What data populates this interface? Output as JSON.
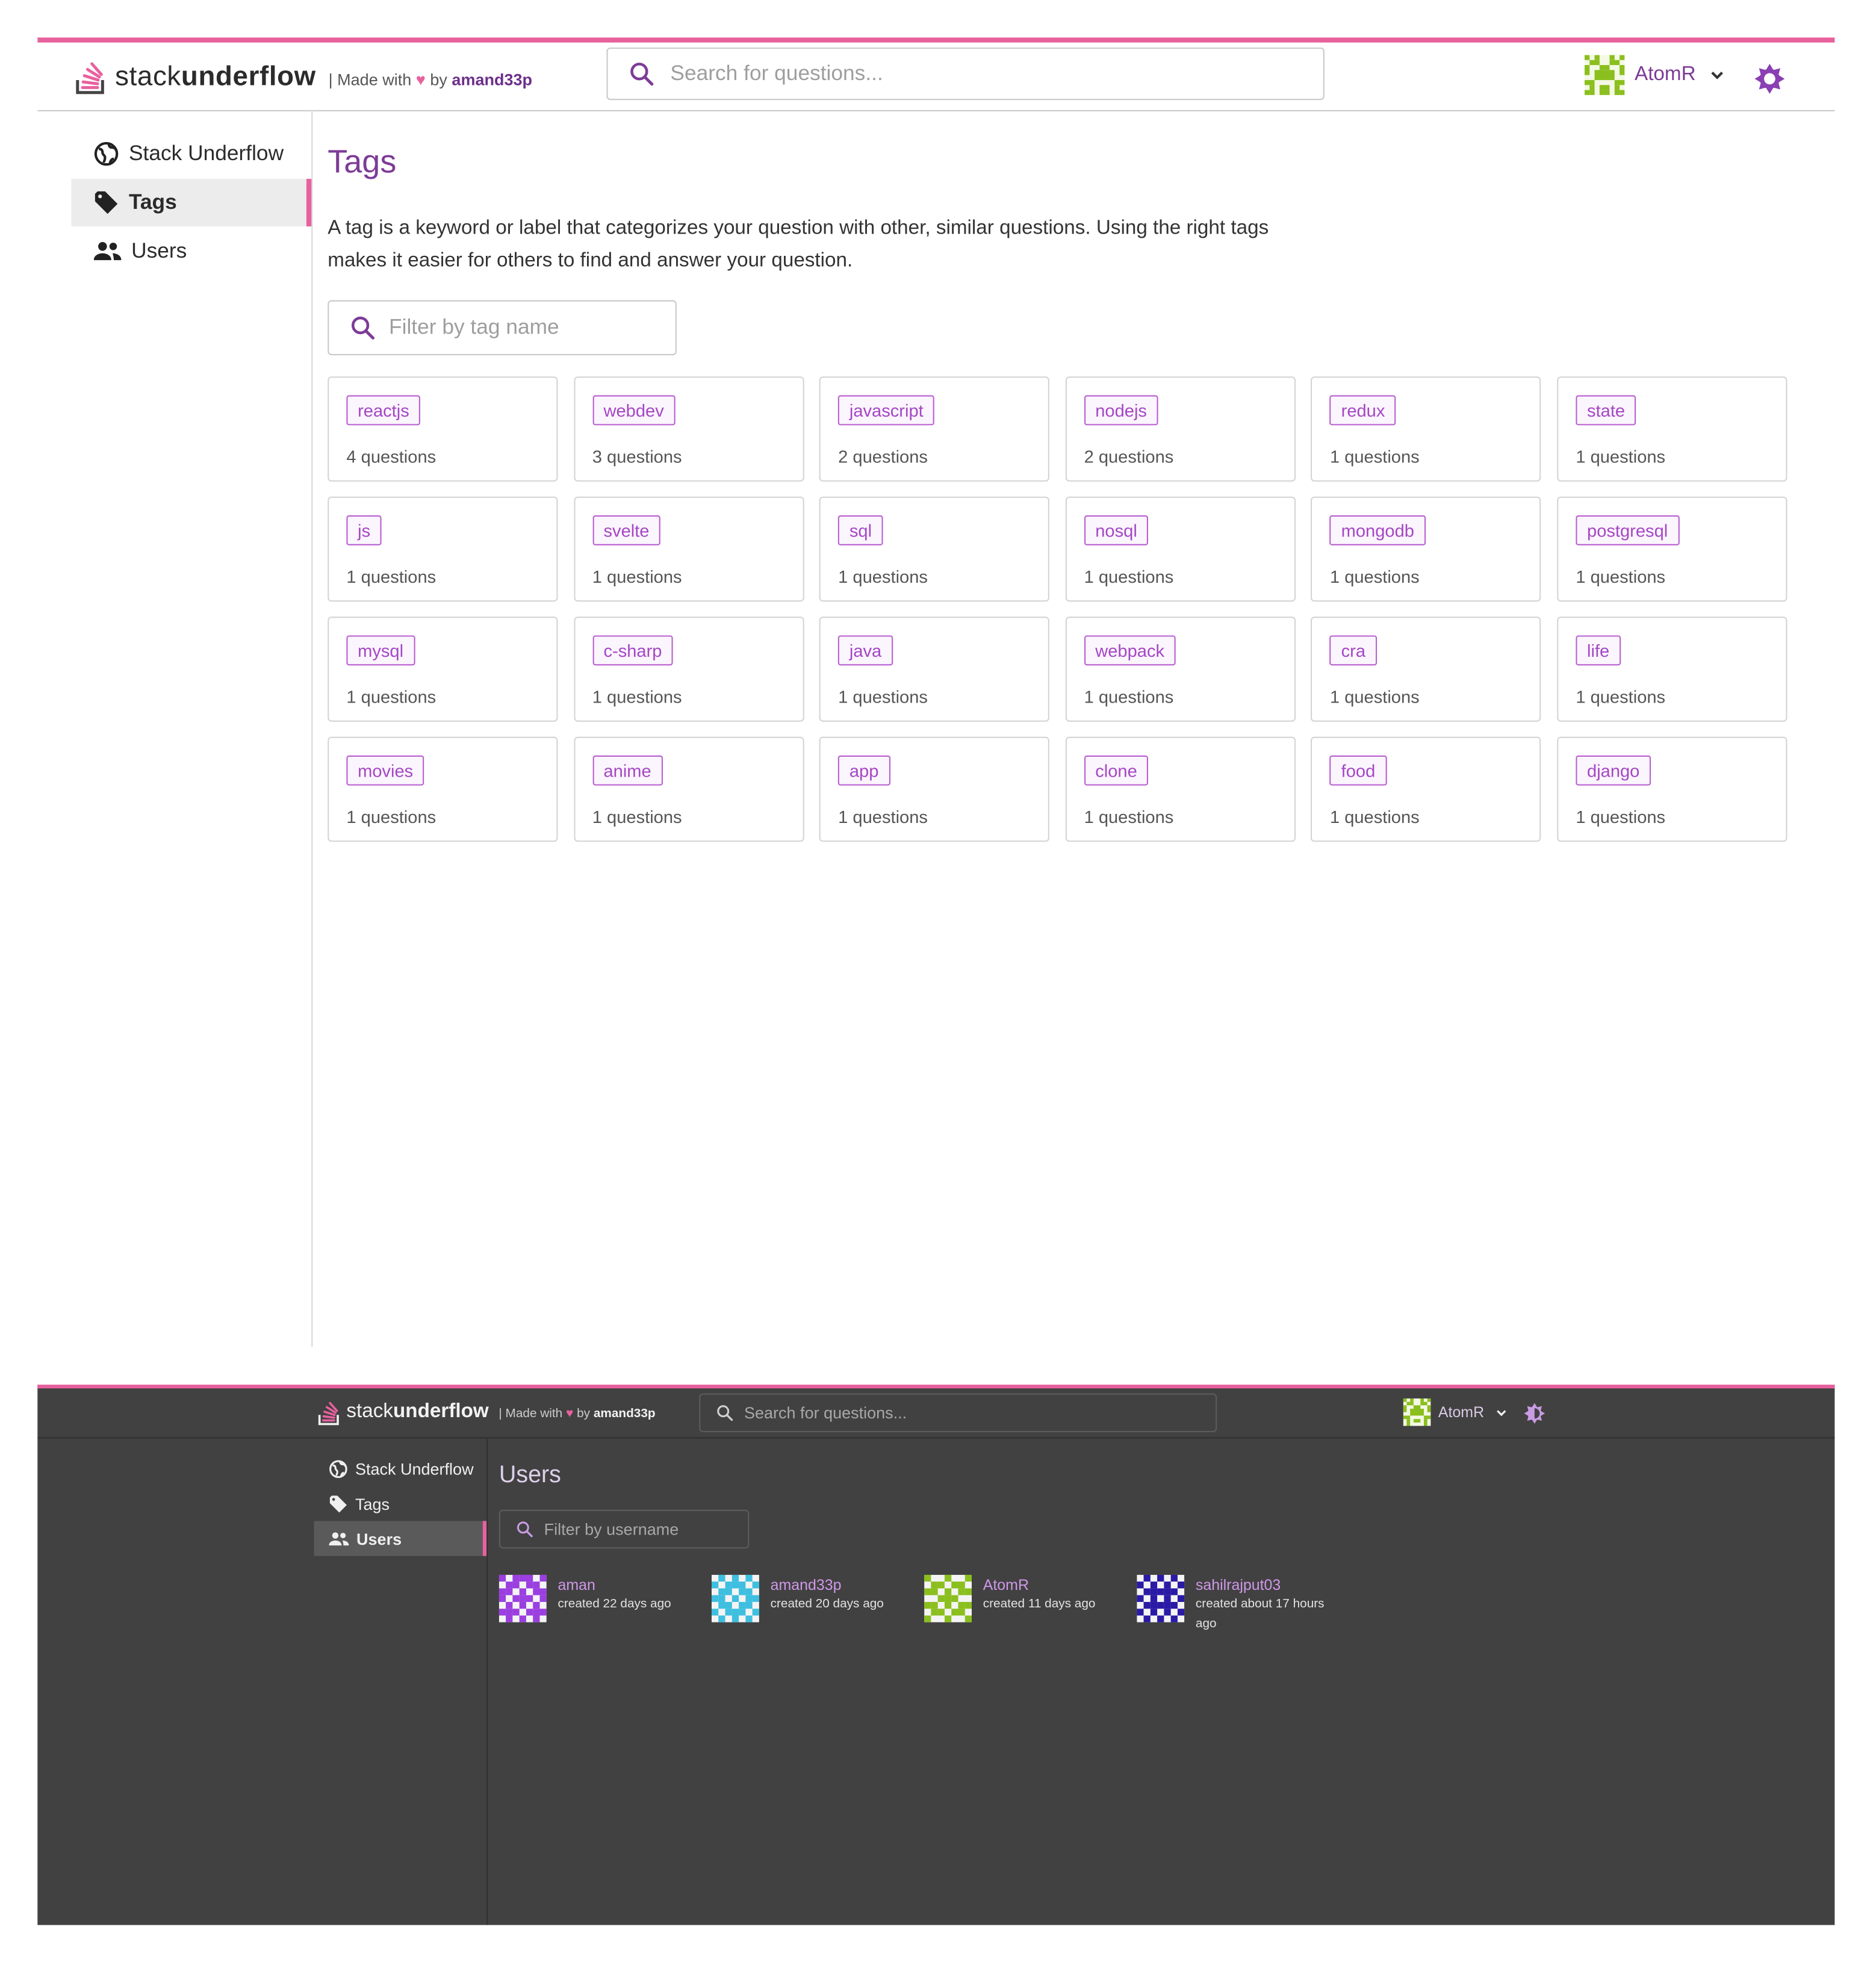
{
  "light": {
    "header": {
      "logo_prefix": "stack",
      "logo_bold": "underflow",
      "made_with": "| Made with",
      "heart": "♥",
      "by": "by",
      "author": "amand33p",
      "search_placeholder": "Search for questions...",
      "username": "AtomR"
    },
    "sidebar": {
      "items": [
        {
          "label": "Stack Underflow",
          "icon": "globe-icon"
        },
        {
          "label": "Tags",
          "icon": "tag-icon"
        },
        {
          "label": "Users",
          "icon": "users-icon"
        }
      ],
      "active": "Tags"
    },
    "page": {
      "title": "Tags",
      "description": "A tag is a keyword or label that categorizes your question with other, similar questions. Using the right tags makes it easier for others to find and answer your question.",
      "filter_placeholder": "Filter by tag name"
    },
    "tags": [
      {
        "name": "reactjs",
        "count": "4 questions"
      },
      {
        "name": "webdev",
        "count": "3 questions"
      },
      {
        "name": "javascript",
        "count": "2 questions"
      },
      {
        "name": "nodejs",
        "count": "2 questions"
      },
      {
        "name": "redux",
        "count": "1 questions"
      },
      {
        "name": "state",
        "count": "1 questions"
      },
      {
        "name": "js",
        "count": "1 questions"
      },
      {
        "name": "svelte",
        "count": "1 questions"
      },
      {
        "name": "sql",
        "count": "1 questions"
      },
      {
        "name": "nosql",
        "count": "1 questions"
      },
      {
        "name": "mongodb",
        "count": "1 questions"
      },
      {
        "name": "postgresql",
        "count": "1 questions"
      },
      {
        "name": "mysql",
        "count": "1 questions"
      },
      {
        "name": "c-sharp",
        "count": "1 questions"
      },
      {
        "name": "java",
        "count": "1 questions"
      },
      {
        "name": "webpack",
        "count": "1 questions"
      },
      {
        "name": "cra",
        "count": "1 questions"
      },
      {
        "name": "life",
        "count": "1 questions"
      },
      {
        "name": "movies",
        "count": "1 questions"
      },
      {
        "name": "anime",
        "count": "1 questions"
      },
      {
        "name": "app",
        "count": "1 questions"
      },
      {
        "name": "clone",
        "count": "1 questions"
      },
      {
        "name": "food",
        "count": "1 questions"
      },
      {
        "name": "django",
        "count": "1 questions"
      }
    ]
  },
  "dark": {
    "header": {
      "logo_prefix": "stack",
      "logo_bold": "underflow",
      "made_with": "| Made with",
      "heart": "♥",
      "by": "by",
      "author": "amand33p",
      "search_placeholder": "Search for questions...",
      "username": "AtomR"
    },
    "sidebar": {
      "items": [
        {
          "label": "Stack Underflow",
          "icon": "globe-icon"
        },
        {
          "label": "Tags",
          "icon": "tag-icon"
        },
        {
          "label": "Users",
          "icon": "users-icon"
        }
      ],
      "active": "Users"
    },
    "page": {
      "title": "Users",
      "filter_placeholder": "Filter by username"
    },
    "users": [
      {
        "name": "aman",
        "created": "created 22 days ago",
        "avatar_color": "#9b3fe0"
      },
      {
        "name": "amand33p",
        "created": "created 20 days ago",
        "avatar_color": "#3ebfe0"
      },
      {
        "name": "AtomR",
        "created": "created 11 days ago",
        "avatar_color": "#8bbf1e"
      },
      {
        "name": "sahilrajput03",
        "created": "created about 17 hours ago",
        "avatar_color": "#2a1aa6"
      }
    ]
  },
  "colors": {
    "accent_pink": "#e8619f",
    "brand_purple": "#7d3b97",
    "tag_purple": "#a447c4",
    "dark_bg": "#414141"
  }
}
